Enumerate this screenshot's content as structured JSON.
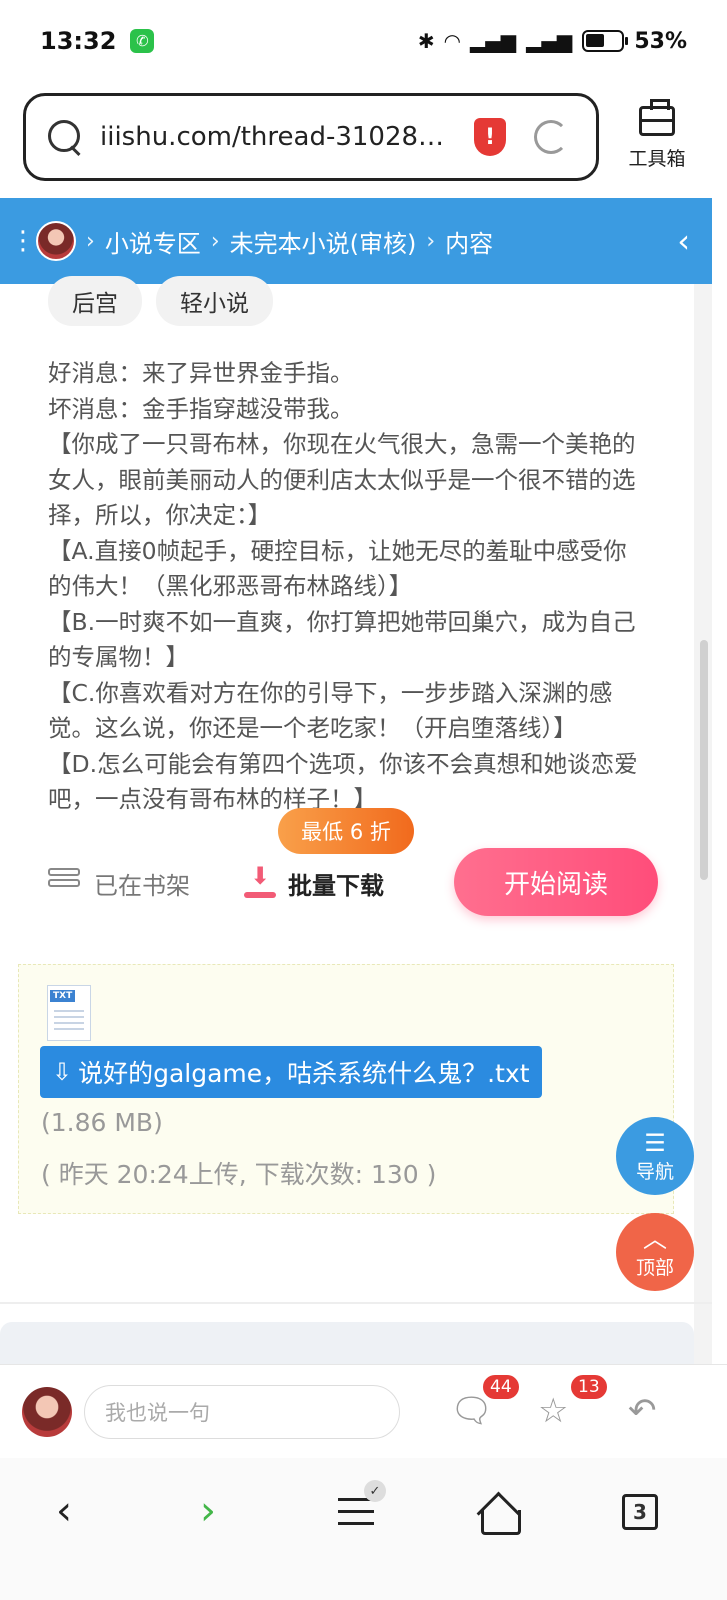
{
  "status_bar": {
    "time": "13:32",
    "battery": "53%",
    "network": "4G"
  },
  "browser": {
    "url": "iiishu.com/thread-310284-...",
    "toolbox_label": "工具箱"
  },
  "breadcrumb": [
    "小说专区",
    "未完本小说(审核)",
    "内容"
  ],
  "tags": [
    "后宫",
    "轻小说"
  ],
  "description": [
    "好消息：来了异世界金手指。",
    "坏消息：金手指穿越没带我。",
    "【你成了一只哥布林，你现在火气很大，急需一个美艳的女人，眼前美丽动人的便利店太太似乎是一个很不错的选择，所以，你决定：】",
    "【A.直接0帧起手，硬控目标，让她无尽的羞耻中感受你的伟大！（黑化邪恶哥布林路线）】",
    "【B.一时爽不如一直爽，你打算把她带回巢穴，成为自己的专属物！】",
    "【C.你喜欢看对方在你的引导下，一步步踏入深渊的感觉。这么说，你还是一个老吃家！（开启堕落线）】",
    "【D.怎么可能会有第四个选项，你该不会真想和她谈恋爱吧，一点没有哥布林的样子！】"
  ],
  "actions": {
    "shelf_label": "已在书架",
    "batch_download_label": "批量下载",
    "discount_label": "最低 6 折",
    "read_label": "开始阅读"
  },
  "attachment": {
    "filename": "说好的galgame，咕杀系统什么鬼？.txt",
    "size": "(1.86 MB)",
    "meta": "( 昨天 20:24上传, 下载次数: 130 )"
  },
  "floating": {
    "nav_label": "导航",
    "top_label": "顶部"
  },
  "comment_bar": {
    "placeholder": "我也说一句",
    "comment_count": "44",
    "favorite_count": "13"
  },
  "bottom_nav": {
    "tab_count": "3"
  },
  "colors": {
    "accent": "#3b9be1",
    "read_button": "#ff4d7a",
    "discount": "#f16a1d",
    "top_button": "#f06548"
  }
}
